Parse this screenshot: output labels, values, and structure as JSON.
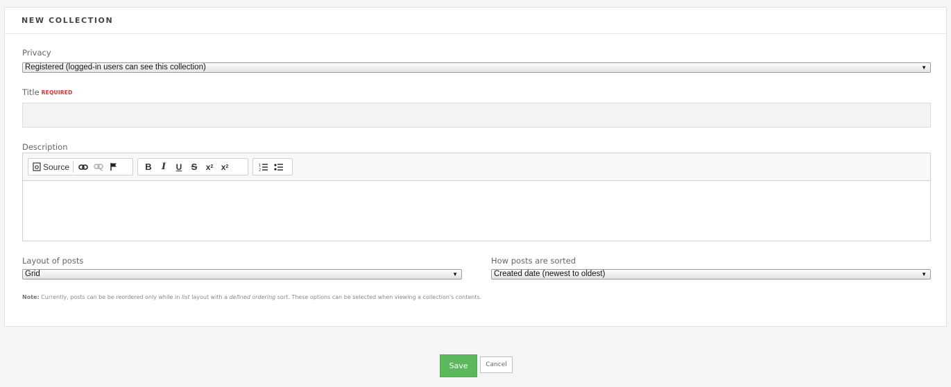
{
  "header": {
    "title": "NEW COLLECTION"
  },
  "privacy": {
    "label": "Privacy",
    "selected": "Registered (logged-in users can see this collection)"
  },
  "title_field": {
    "label": "Title",
    "required": "REQUIRED",
    "value": ""
  },
  "description": {
    "label": "Description",
    "toolbar": {
      "source_label": "Source",
      "icons": [
        "source-icon",
        "link-icon",
        "unlink-icon",
        "anchor-icon",
        "bold-icon",
        "italic-icon",
        "underline-icon",
        "strikethrough-icon",
        "subscript-icon",
        "superscript-icon",
        "numbered-list-icon",
        "bulleted-list-icon"
      ]
    }
  },
  "layout": {
    "label": "Layout of posts",
    "selected": "Grid"
  },
  "sort": {
    "label": "How posts are sorted",
    "selected": "Created date (newest to oldest)"
  },
  "note": {
    "prefix": "Note:",
    "part1": " Currently, posts can be be reordered only while in ",
    "em1": "list",
    "part2": " layout with a ",
    "em2": "defined ordering",
    "part3": " sort. These options can be selected when viewing a collection's contents."
  },
  "actions": {
    "save_label": "Save",
    "cancel_label": "Cancel"
  },
  "colors": {
    "save_bg": "#5cb85c",
    "required": "#d9342b"
  }
}
